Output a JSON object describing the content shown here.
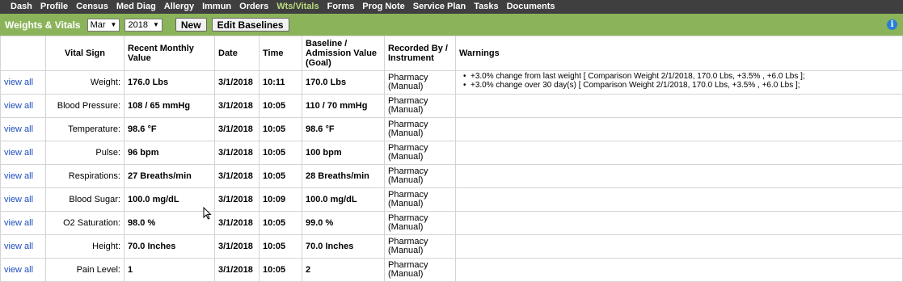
{
  "nav": {
    "tabs": [
      "Dash",
      "Profile",
      "Census",
      "Med Diag",
      "Allergy",
      "Immun",
      "Orders",
      "Wts/Vitals",
      "Forms",
      "Prog Note",
      "Service Plan",
      "Tasks",
      "Documents"
    ],
    "active": "Wts/Vitals"
  },
  "toolbar": {
    "title": "Weights & Vitals",
    "month": "Mar",
    "year": "2018",
    "new_label": "New",
    "edit_label": "Edit Baselines"
  },
  "table": {
    "headers": {
      "view": "",
      "vital": "Vital Sign",
      "recent": "Recent Monthly Value",
      "date": "Date",
      "time": "Time",
      "baseline": "Baseline / Admission Value (Goal)",
      "recorded": "Recorded By / Instrument",
      "warnings": "Warnings"
    },
    "rows": [
      {
        "link": "view all",
        "vital": "Weight:",
        "value": "176.0 Lbs",
        "date": "3/1/2018",
        "time": "10:11",
        "baseline": "170.0 Lbs",
        "recorded": "Pharmacy (Manual)",
        "warnings": [
          "+3.0% change from last weight [ Comparison Weight 2/1/2018, 170.0 Lbs, +3.5% , +6.0 Lbs ];",
          "+3.0% change over 30 day(s) [ Comparison Weight 2/1/2018, 170.0 Lbs, +3.5% , +6.0 Lbs ];"
        ]
      },
      {
        "link": "view all",
        "vital": "Blood Pressure:",
        "value": "108 /  65 mmHg",
        "date": "3/1/2018",
        "time": "10:05",
        "baseline": "110  /  70 mmHg",
        "recorded": "Pharmacy (Manual)",
        "warnings": []
      },
      {
        "link": "view all",
        "vital": "Temperature:",
        "value": "98.6 °F",
        "date": "3/1/2018",
        "time": "10:05",
        "baseline": "98.6 °F",
        "recorded": "Pharmacy (Manual)",
        "warnings": []
      },
      {
        "link": "view all",
        "vital": "Pulse:",
        "value": "96 bpm",
        "date": "3/1/2018",
        "time": "10:05",
        "baseline": "100 bpm",
        "recorded": "Pharmacy (Manual)",
        "warnings": []
      },
      {
        "link": "view all",
        "vital": "Respirations:",
        "value": "27 Breaths/min",
        "date": "3/1/2018",
        "time": "10:05",
        "baseline": "28 Breaths/min",
        "recorded": "Pharmacy (Manual)",
        "warnings": []
      },
      {
        "link": "view all",
        "vital": "Blood Sugar:",
        "value": "100.0 mg/dL",
        "date": "3/1/2018",
        "time": "10:09",
        "baseline": "100.0 mg/dL",
        "recorded": "Pharmacy (Manual)",
        "warnings": []
      },
      {
        "link": "view all",
        "vital": "O2 Saturation:",
        "value": "98.0 %",
        "date": "3/1/2018",
        "time": "10:05",
        "baseline": "99.0 %",
        "recorded": "Pharmacy (Manual)",
        "warnings": []
      },
      {
        "link": "view all",
        "vital": "Height:",
        "value": "70.0 Inches",
        "date": "3/1/2018",
        "time": "10:05",
        "baseline": "70.0 Inches",
        "recorded": "Pharmacy (Manual)",
        "warnings": []
      },
      {
        "link": "view all",
        "vital": "Pain Level:",
        "value": "1",
        "date": "3/1/2018",
        "time": "10:05",
        "baseline": "2",
        "recorded": "Pharmacy (Manual)",
        "warnings": []
      }
    ]
  }
}
